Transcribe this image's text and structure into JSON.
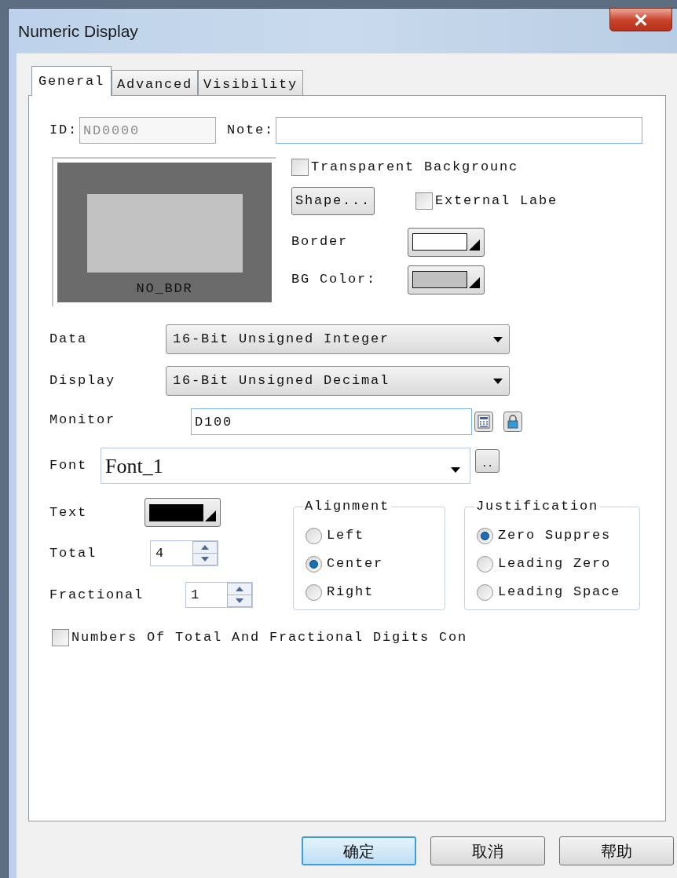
{
  "window": {
    "title": "Numeric Display"
  },
  "tabs": [
    {
      "label": "General",
      "selected": true
    },
    {
      "label": "Advanced",
      "selected": false
    },
    {
      "label": "Visibility",
      "selected": false
    }
  ],
  "id_field": {
    "label": "ID:",
    "value": "ND0000",
    "disabled": true
  },
  "note_field": {
    "label": "Note:"
  },
  "preview": {
    "caption": "NO_BDR"
  },
  "transparent_background": {
    "label": "Transparent Backgrounc",
    "checked": false
  },
  "shape_button": "Shape...",
  "external_label": {
    "label": "External Labe",
    "checked": false
  },
  "color_pickers": [
    {
      "label": "Border",
      "color": "#ffffff"
    },
    {
      "label": "BG Color:",
      "color": "#c0c0c0"
    }
  ],
  "data": {
    "label": "Data",
    "value": "16-Bit Unsigned Integer"
  },
  "display": {
    "label": "Display",
    "value": "16-Bit Unsigned Decimal"
  },
  "monitor": {
    "label": "Monitor",
    "value": "D100"
  },
  "font": {
    "label": "Font",
    "value": "Font_1",
    "browse": ".."
  },
  "text_color": {
    "label": "Text",
    "color": "#000000"
  },
  "total": {
    "label": "Total",
    "value": "4"
  },
  "fractional": {
    "label": "Fractional",
    "value": "1"
  },
  "alignment": {
    "title": "Alignment",
    "options": [
      {
        "label": "Left",
        "selected": false
      },
      {
        "label": "Center",
        "selected": true
      },
      {
        "label": "Right",
        "selected": false
      }
    ]
  },
  "justification": {
    "title": "Justification",
    "options": [
      {
        "label": "Zero Suppres",
        "selected": true
      },
      {
        "label": "Leading Zero",
        "selected": false
      },
      {
        "label": "Leading Space",
        "selected": false
      }
    ]
  },
  "digits_checkbox": {
    "label": "Numbers Of Total And Fractional Digits Con",
    "checked": false
  },
  "buttons": [
    {
      "label": "确定",
      "default": true
    },
    {
      "label": "取消",
      "default": false
    },
    {
      "label": "帮助",
      "default": false
    }
  ]
}
